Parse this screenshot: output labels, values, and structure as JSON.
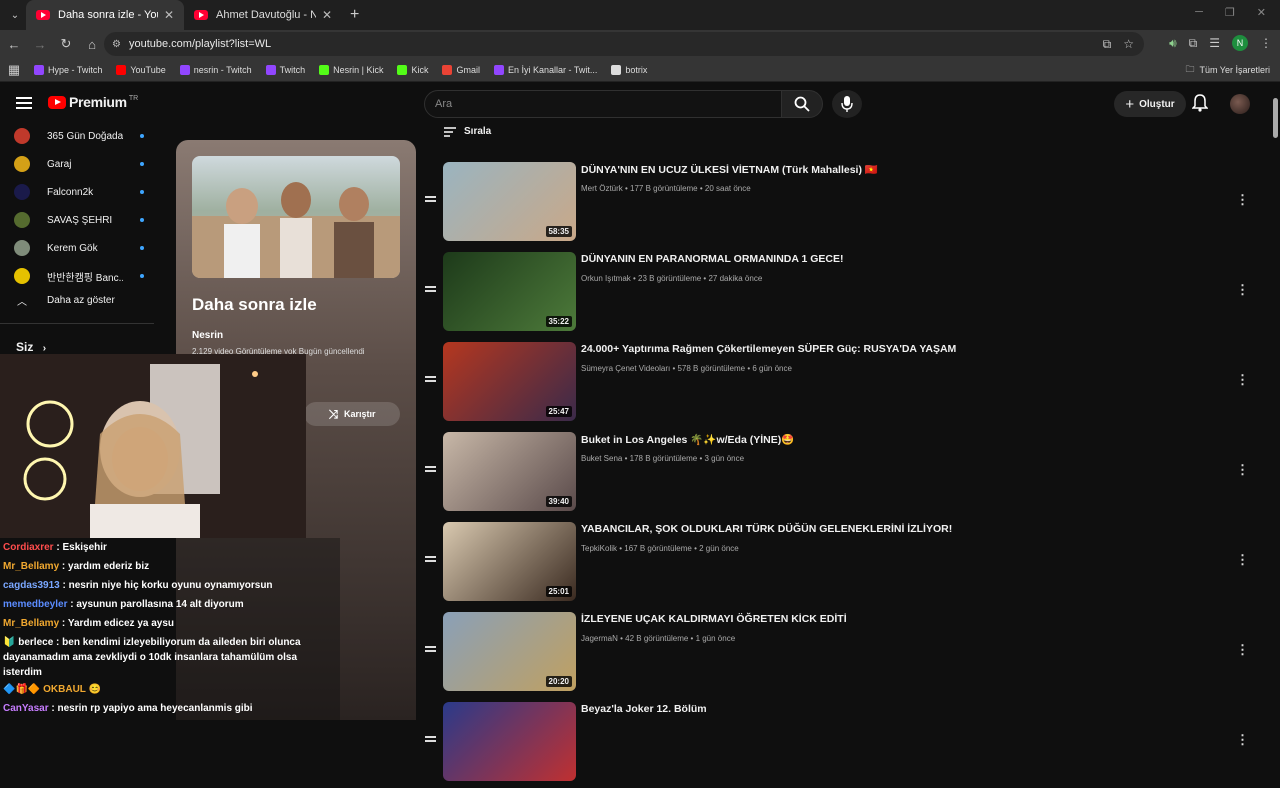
{
  "browser": {
    "tabs": [
      {
        "title": "Daha sonra izle - YouTube",
        "active": true
      },
      {
        "title": "Ahmet Davutoğlu - Nevşehir - ",
        "active": false
      }
    ],
    "url": "youtube.com/playlist?list=WL",
    "bookmarks": [
      {
        "label": "Hype - Twitch",
        "color": "#9146ff"
      },
      {
        "label": "YouTube",
        "color": "#ff0000"
      },
      {
        "label": "nesrin - Twitch",
        "color": "#9146ff"
      },
      {
        "label": "Twitch",
        "color": "#9146ff"
      },
      {
        "label": "Nesrin | Kick",
        "color": "#53fc18"
      },
      {
        "label": "Kick",
        "color": "#53fc18"
      },
      {
        "label": "Gmail",
        "color": "#ea4335"
      },
      {
        "label": "En İyi Kanallar - Twit...",
        "color": "#9146ff"
      },
      {
        "label": "botrix",
        "color": "#dddddd"
      }
    ],
    "all_bookmarks": "Tüm Yer İşaretleri",
    "profile_initial": "N"
  },
  "youtube": {
    "logo_text": "Premium",
    "logo_region": "TR",
    "search_placeholder": "Ara",
    "create_label": "Oluştur",
    "subscriptions": [
      {
        "name": "365 Gün Doğada...",
        "color": "#c0392b"
      },
      {
        "name": "Garaj",
        "color": "#d4a017"
      },
      {
        "name": "Falconn2k",
        "color": "#1a1a4a"
      },
      {
        "name": "SAVAŞ ŞEHRİ",
        "color": "#556b2f"
      },
      {
        "name": "Kerem Gök",
        "color": "#7f8c7a"
      },
      {
        "name": "반반한캠핑 Banc...",
        "color": "#e5c100"
      }
    ],
    "show_less": "Daha az göster",
    "you_label": "Siz",
    "playlist": {
      "title": "Daha sonra izle",
      "owner": "Nesrin",
      "meta": "2.129 video  Görüntüleme yok  Bugün güncellendi",
      "shuffle_label": "Karıştır"
    },
    "sort_label": "Sırala",
    "videos": [
      {
        "title": "DÜNYA'NIN EN UCUZ ÜLKESİ VİETNAM (Türk Mahallesi) 🇻🇳",
        "channel": "Mert Öztürk",
        "views": "177 B görüntüleme",
        "age": "20 saat önce",
        "duration": "58:35",
        "thumb": [
          "#9ab4c0",
          "#c9a888"
        ]
      },
      {
        "title": "DÜNYANIN EN PARANORMAL ORMANINDA 1 GECE!",
        "channel": "Orkun Işıtmak",
        "views": "23 B görüntüleme",
        "age": "27 dakika önce",
        "duration": "35:22",
        "thumb": [
          "#1d3a1a",
          "#4d7a3a"
        ]
      },
      {
        "title": "24.000+ Yaptırıma Rağmen Çökertilemeyen SÜPER Güç: RUSYA'DA YAŞAM",
        "channel": "Sümeyra Çenet Videoları",
        "views": "578 B görüntüleme",
        "age": "6 gün önce",
        "duration": "25:47",
        "thumb": [
          "#b5371f",
          "#3a2a4a"
        ]
      },
      {
        "title": "Buket in Los Angeles 🌴✨w/Eda (YİNE)🤩",
        "channel": "Buket Sena",
        "views": "178 B görüntüleme",
        "age": "3 gün önce",
        "duration": "39:40",
        "thumb": [
          "#c8b8a8",
          "#5a4a4a"
        ]
      },
      {
        "title": "YABANCILAR, ŞOK OLDUKLARI TÜRK DÜĞÜN GELENEKLERİNİ İZLİYOR!",
        "channel": "TepkiKolik",
        "views": "167 B görüntüleme",
        "age": "2 gün önce",
        "duration": "25:01",
        "thumb": [
          "#d9c9b0",
          "#3a2a20"
        ]
      },
      {
        "title": "İZLEYENE UÇAK KALDIRMAYI ÖĞRETEN KİCK EDİTİ",
        "channel": "JagermaN",
        "views": "42 B görüntüleme",
        "age": "1 gün önce",
        "duration": "20:20",
        "thumb": [
          "#8aa0b8",
          "#c0a060"
        ]
      },
      {
        "title": "Beyaz'la Joker 12. Bölüm",
        "channel": "",
        "views": "",
        "age": "",
        "duration": "",
        "thumb": [
          "#2a3a8a",
          "#c03030"
        ]
      }
    ]
  },
  "chat": [
    {
      "user": "Cordiaxrer",
      "user_color": "#ff4d4d",
      "msg": "Eskişehir"
    },
    {
      "user": "Mr_Bellamy",
      "user_color": "#f0a830",
      "msg": "yardım ederiz biz"
    },
    {
      "user": "cagdas3913",
      "user_color": "#7aa7ff",
      "msg": "nesrin niye hiç korku oyunu oynamıyorsun"
    },
    {
      "user": "memedbeyler",
      "user_color": "#5b8cff",
      "msg": "aysunun parollasına 14 alt diyorum"
    },
    {
      "user": "Mr_Bellamy",
      "user_color": "#f0a830",
      "msg": "Yardım edicez ya aysu"
    },
    {
      "user": "🔰 berlece",
      "user_color": "#ffffff",
      "msg": "ben kendimi izleyebiliyorum da aileden biri olunca dayanamadım ama zevkliydi o 10dk insanlara tahamülüm olsa isterdim"
    },
    {
      "user": "🔷🎁🔶 OKBAUL 😊",
      "user_color": "#f0a830",
      "msg": ""
    },
    {
      "user": "CanYasar",
      "user_color": "#c77dff",
      "msg": "nesrin rp yapiyo ama heyecanlanmis gibi"
    }
  ]
}
